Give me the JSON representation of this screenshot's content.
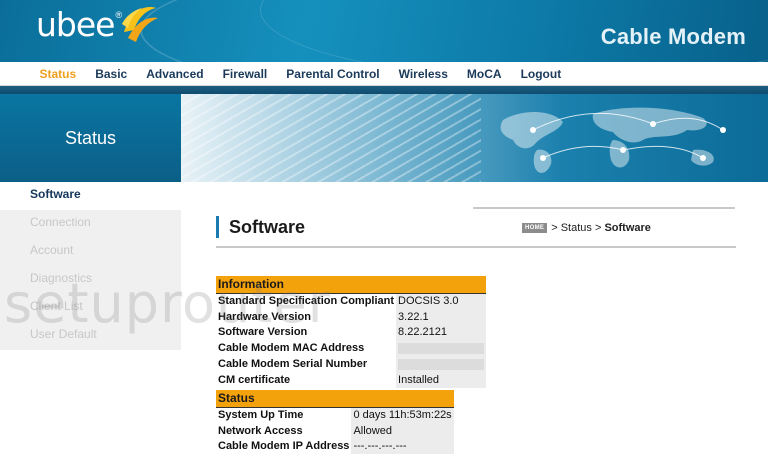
{
  "header": {
    "logo_text": "ubee",
    "logo_mark": "®",
    "device_title": "Cable Modem"
  },
  "nav": {
    "items": [
      {
        "label": "Status",
        "active": true
      },
      {
        "label": "Basic"
      },
      {
        "label": "Advanced"
      },
      {
        "label": "Firewall"
      },
      {
        "label": "Parental Control"
      },
      {
        "label": "Wireless"
      },
      {
        "label": "MoCA"
      },
      {
        "label": "Logout"
      }
    ]
  },
  "banner": {
    "section_title": "Status"
  },
  "sidebar": {
    "items": [
      {
        "label": "Software",
        "active": true
      },
      {
        "label": "Connection"
      },
      {
        "label": "Account"
      },
      {
        "label": "Diagnostics"
      },
      {
        "label": "Client List"
      },
      {
        "label": "User Default"
      }
    ]
  },
  "page": {
    "title": "Software",
    "breadcrumb": {
      "home_icon": "HOME",
      "separator": ">",
      "parent": "Status",
      "current": "Software"
    }
  },
  "information": {
    "header": "Information",
    "rows": [
      {
        "label": "Standard Specification Compliant",
        "value": "DOCSIS 3.0"
      },
      {
        "label": "Hardware Version",
        "value": "3.22.1"
      },
      {
        "label": "Software Version",
        "value": "8.22.2121"
      },
      {
        "label": "Cable Modem MAC Address",
        "value": ""
      },
      {
        "label": "Cable Modem Serial Number",
        "value": ""
      },
      {
        "label": "CM certificate",
        "value": "Installed"
      }
    ]
  },
  "status": {
    "header": "Status",
    "rows": [
      {
        "label": "System Up Time",
        "value": "0 days 11h:53m:22s"
      },
      {
        "label": "Network Access",
        "value": "Allowed"
      },
      {
        "label": "Cable Modem IP Address",
        "value": "---.---.---.---"
      }
    ]
  },
  "watermark": "setuprouter",
  "colors": {
    "accent_orange": "#f4a20c",
    "header_blue": "#1590bd",
    "nav_text": "#1a3a5a",
    "nav_active": "#f0a020"
  }
}
